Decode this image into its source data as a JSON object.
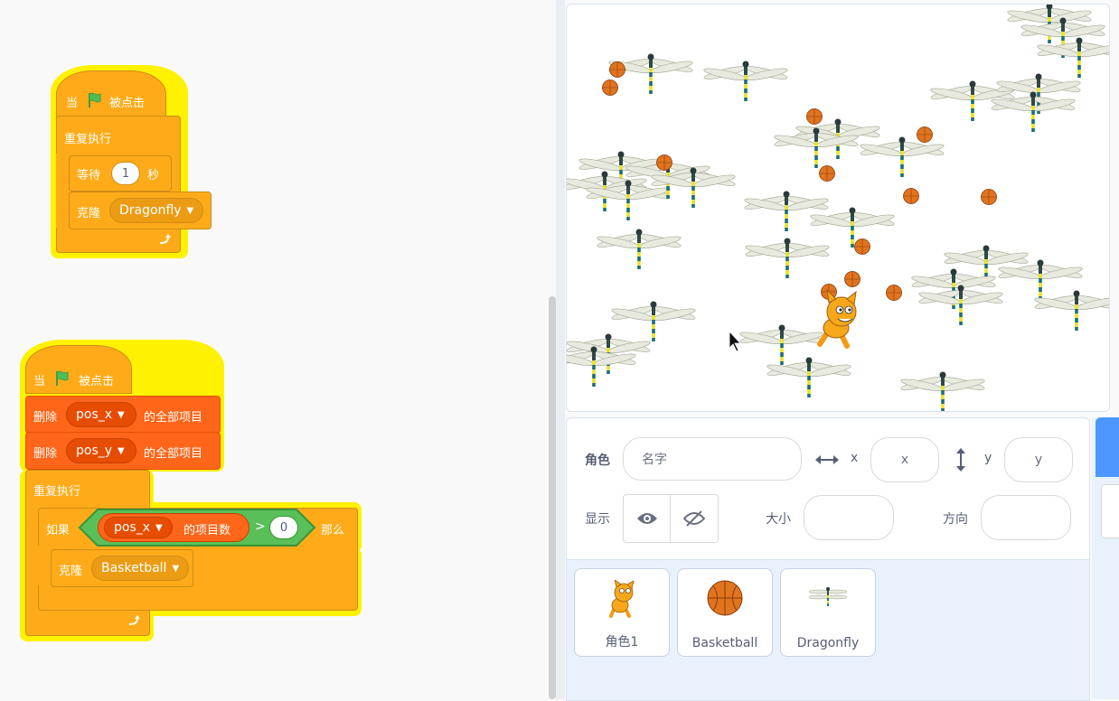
{
  "workspace": {
    "script1": {
      "when": "当",
      "clicked": "被点击",
      "forever": "重复执行",
      "wait": "等待",
      "wait_value": "1",
      "seconds": "秒",
      "clone": "克隆",
      "clone_target": "Dragonfly"
    },
    "script2": {
      "when": "当",
      "clicked": "被点击",
      "delete": "删除",
      "list1": "pos_x",
      "all_items": "的全部项目",
      "list2": "pos_y",
      "forever": "重复执行",
      "if": "如果",
      "list3": "pos_x",
      "length_of": "的项目数",
      "gt": ">",
      "zero": "0",
      "then": "那么",
      "clone": "克隆",
      "clone_target": "Basketball"
    }
  },
  "sprite_info": {
    "sprite_label": "角色",
    "name_placeholder": "名字",
    "x_label": "x",
    "x_placeholder": "x",
    "y_label": "y",
    "y_placeholder": "y",
    "show_label": "显示",
    "size_label": "大小",
    "direction_label": "方向"
  },
  "sprites": [
    {
      "name": "角色1",
      "icon": "cat-sprite-icon"
    },
    {
      "name": "Basketball",
      "icon": "basketball-sprite-icon"
    },
    {
      "name": "Dragonfly",
      "icon": "dragonfly-sprite-icon"
    }
  ],
  "colors": {
    "events": "#ffab19",
    "control": "#ffab19",
    "variables_list": "#ff661a",
    "operators": "#59c059",
    "glow": "#fff200",
    "accent": "#4c97ff"
  }
}
